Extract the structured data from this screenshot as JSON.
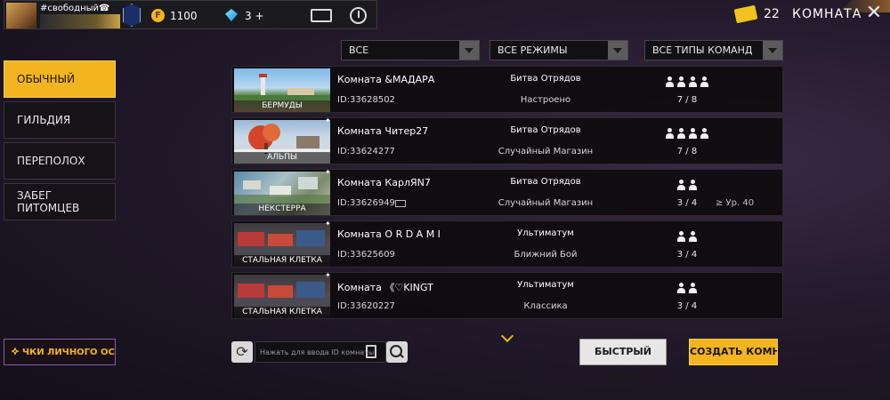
{
  "header": {
    "nickname": "#свободный☎",
    "coins": "1100",
    "coin_symbol": "F",
    "diamonds": "3 +",
    "tickets": "22",
    "title": "КОМНАТА",
    "close_glyph": "✕"
  },
  "sidebar": {
    "tabs": [
      {
        "label": "ОБЫЧНЫЙ",
        "active": true
      },
      {
        "label": "ГИЛЬДИЯ",
        "active": false
      },
      {
        "label": "ПЕРЕПОЛОХ",
        "active": false
      },
      {
        "label": "ЗАБЕГ ПИТОМЦЕВ",
        "active": false
      }
    ],
    "collect_label": "ЧКИ ЛИЧНОГО ОСТ"
  },
  "filters": {
    "region": "ВСЕ",
    "modes": "ВСЕ РЕЖИМЫ",
    "team_types": "ВСЕ ТИПЫ КОМАНД"
  },
  "rooms": [
    {
      "map": "БЕРМУДЫ",
      "name": "Комната &МАДАРА",
      "id": "ID:33628502",
      "mode": "Битва Отрядов",
      "sub": "Настроено",
      "count": "7 / 8",
      "players": 4,
      "level": "",
      "star": false
    },
    {
      "map": "АЛЬПЫ",
      "name": "Комната Читер27",
      "id": "ID:33624277",
      "mode": "Битва Отрядов",
      "sub": "Случайный Магазин",
      "count": "7 / 8",
      "players": 4,
      "level": "",
      "star": true
    },
    {
      "map": "НЕКСТЕРРА",
      "name": "Комната КарлЯN7",
      "id": "ID:33626949",
      "mode": "Битва Отрядов",
      "sub": "Случайный Магазин",
      "count": "3 / 4",
      "players": 2,
      "level": "≥ Ур. 40",
      "star": true
    },
    {
      "map": "СТАЛЬНАЯ КЛЕТКА",
      "name": "Комната О R  D A M I",
      "id": "ID:33625609",
      "mode": "Ультиматум",
      "sub": "Ближний Бой",
      "count": "3 / 4",
      "players": 2,
      "level": "",
      "star": true
    },
    {
      "map": "СТАЛЬНАЯ КЛЕТКА",
      "name": "Комната 《♡KINGT",
      "id": "ID:33620227",
      "mode": "Ультиматум",
      "sub": "Классика",
      "count": "3 / 4",
      "players": 2,
      "level": "",
      "star": true
    }
  ],
  "bottom": {
    "search_placeholder": "Нажать для ввода ID комнаты",
    "quick_join": "БЫСТРЫЙ ВХОД",
    "create_room": "СОЗДАТЬ КОМНАТУ",
    "refresh_glyph": "⟳"
  },
  "colors": {
    "accent": "#f2b51f",
    "panel": "#0e0c0f"
  }
}
